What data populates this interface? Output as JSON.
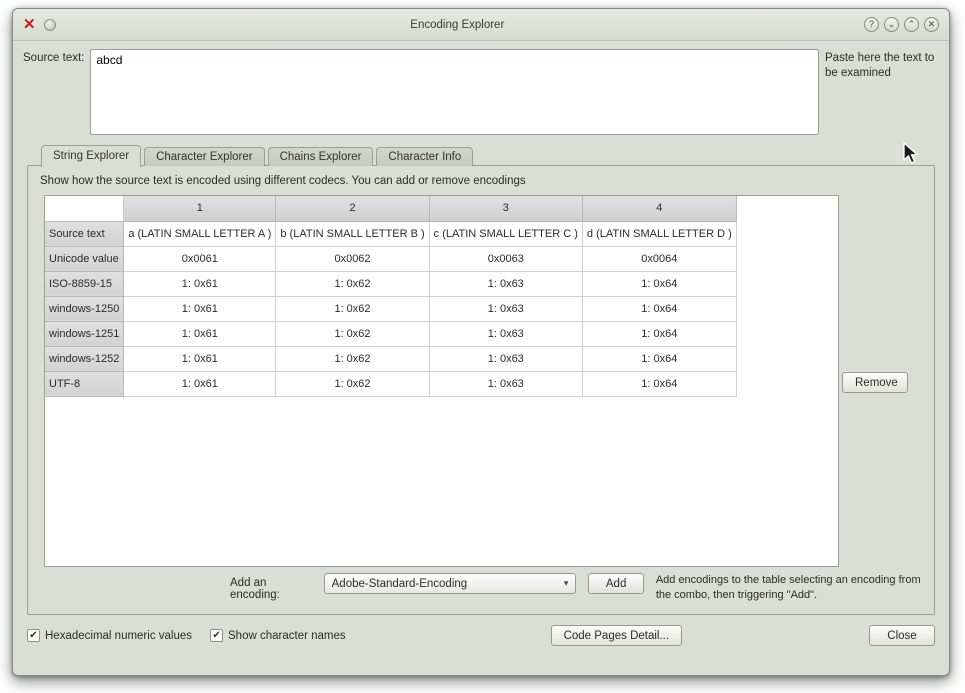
{
  "window": {
    "title": "Encoding Explorer",
    "left_close_glyph": "✕",
    "buttons": {
      "help": "?",
      "shade_down": "⌄",
      "shade_up": "⌃",
      "close": "✕"
    }
  },
  "source": {
    "label": "Source text:",
    "value": "abcd",
    "hint": "Paste here the text to be examined"
  },
  "tabs": [
    {
      "label": "String Explorer",
      "active": true
    },
    {
      "label": "Character Explorer",
      "active": false
    },
    {
      "label": "Chains Explorer",
      "active": false
    },
    {
      "label": "Character Info",
      "active": false
    }
  ],
  "description": "Show how the source text is encoded using different codecs. You can add or remove encodings",
  "table": {
    "col_headers": [
      "1",
      "2",
      "3",
      "4"
    ],
    "rows": [
      {
        "header": "Source text",
        "cells": [
          "a (LATIN SMALL LETTER A )",
          "b (LATIN SMALL LETTER B )",
          "c (LATIN SMALL LETTER C )",
          "d (LATIN SMALL LETTER D )"
        ]
      },
      {
        "header": "Unicode value",
        "cells": [
          "0x0061",
          "0x0062",
          "0x0063",
          "0x0064"
        ]
      },
      {
        "header": "ISO-8859-15",
        "cells": [
          "1: 0x61",
          "1: 0x62",
          "1: 0x63",
          "1: 0x64"
        ]
      },
      {
        "header": "windows-1250",
        "cells": [
          "1: 0x61",
          "1: 0x62",
          "1: 0x63",
          "1: 0x64"
        ]
      },
      {
        "header": "windows-1251",
        "cells": [
          "1: 0x61",
          "1: 0x62",
          "1: 0x63",
          "1: 0x64"
        ]
      },
      {
        "header": "windows-1252",
        "cells": [
          "1: 0x61",
          "1: 0x62",
          "1: 0x63",
          "1: 0x64"
        ]
      },
      {
        "header": "UTF-8",
        "cells": [
          "1: 0x61",
          "1: 0x62",
          "1: 0x63",
          "1: 0x64"
        ]
      }
    ]
  },
  "remove_button": "Remove",
  "add_row": {
    "label": "Add an encoding:",
    "combo_value": "Adobe-Standard-Encoding",
    "combo_arrow": "▾",
    "add_button": "Add",
    "hint": "Add encodings to the table selecting an encoding from the combo, then triggering \"Add\"."
  },
  "footer": {
    "checkbox_hex": {
      "label": "Hexadecimal numeric values",
      "checked": true,
      "glyph": "✔"
    },
    "checkbox_names": {
      "label": "Show character names",
      "checked": true,
      "glyph": "✔"
    },
    "code_pages_button": "Code Pages Detail...",
    "close_button": "Close"
  }
}
